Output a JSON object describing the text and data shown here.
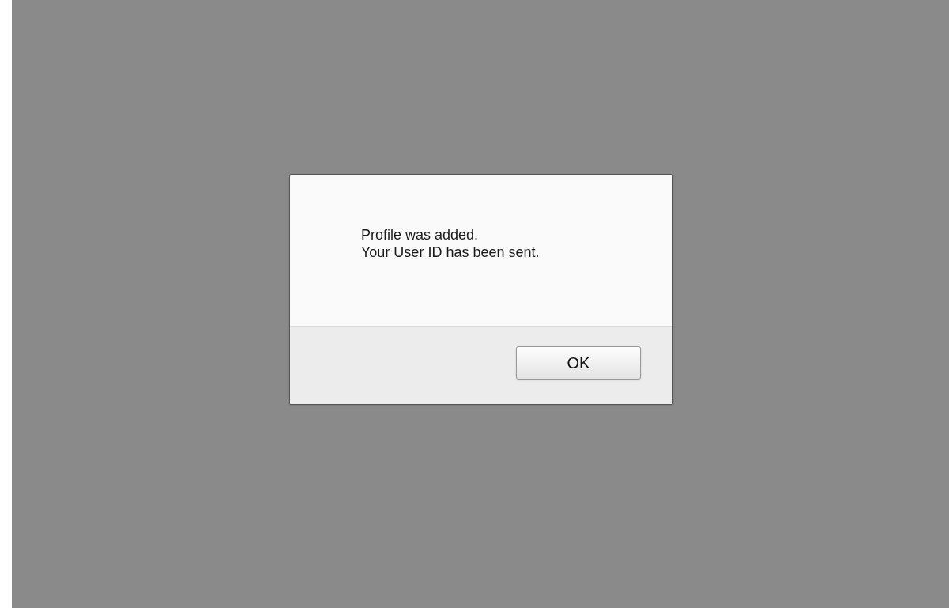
{
  "dialog": {
    "message": [
      "Profile was added.",
      "Your User ID has been sent."
    ],
    "buttons": [
      "OK"
    ]
  }
}
